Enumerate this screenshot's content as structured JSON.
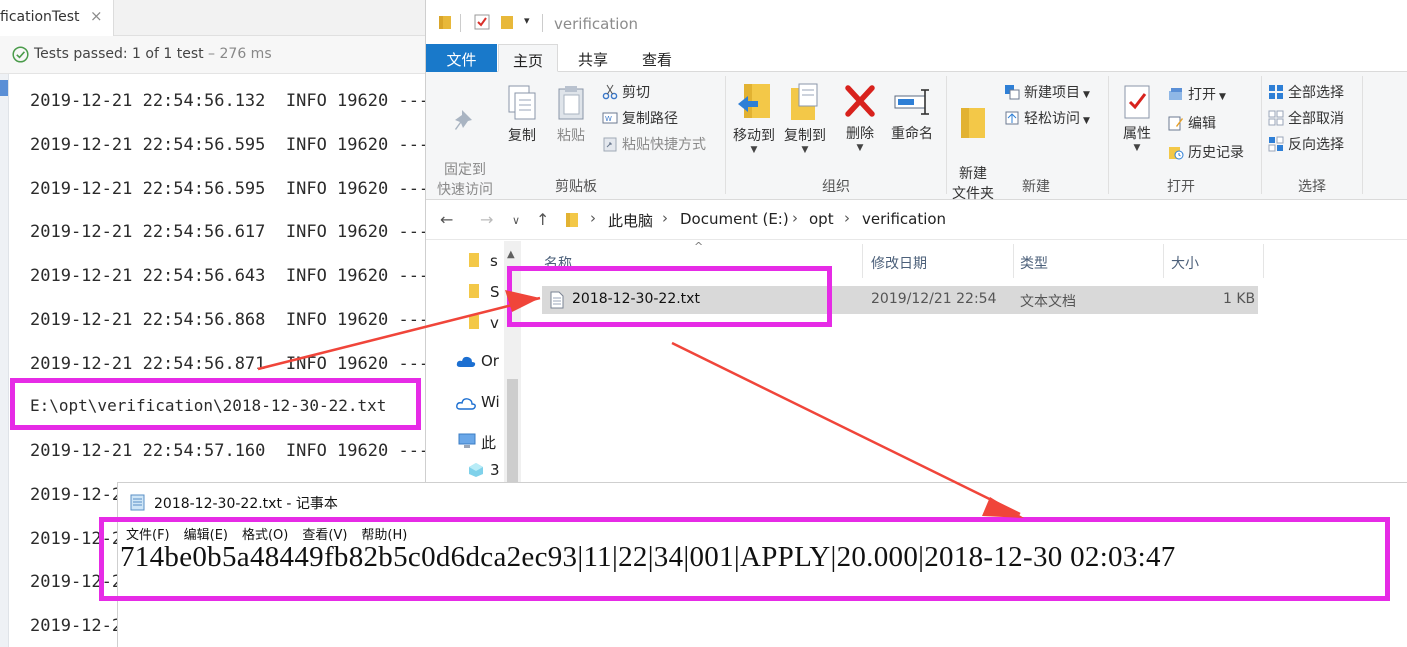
{
  "ide": {
    "tab_title": "ficationTest",
    "tab_close": "×",
    "status_prefix": "Tests passed: ",
    "status_count": "1",
    "status_mid": " of 1 test",
    "status_time": " – 276 ms",
    "log_lines": [
      "2019-12-21 22:54:56.132  INFO 19620 ---",
      "2019-12-21 22:54:56.595  INFO 19620 ---",
      "2019-12-21 22:54:56.595  INFO 19620 ---",
      "2019-12-21 22:54:56.617  INFO 19620 ---",
      "2019-12-21 22:54:56.643  INFO 19620 ---",
      "2019-12-21 22:54:56.868  INFO 19620 ---",
      "2019-12-21 22:54:56.871  INFO 19620 ---",
      "2019-12-21 22:54:57.160  INFO 19620 ---",
      "2019-12-2",
      "2019-12-2",
      "2019-12-2",
      "2019-12-2"
    ],
    "path_line": "E:\\opt\\verification\\2018-12-30-22.txt"
  },
  "explorer": {
    "title": "verification",
    "tabs": {
      "file": "文件",
      "home": "主页",
      "share": "共享",
      "view": "查看"
    },
    "ribbon": {
      "pin": "固定到\n快速访问",
      "copy": "复制",
      "paste": "粘贴",
      "cut": "剪切",
      "copy_path": "复制路径",
      "paste_shortcut": "粘贴快捷方式",
      "clipboard_group": "剪贴板",
      "move_to": "移动到",
      "copy_to": "复制到",
      "delete": "删除",
      "rename": "重命名",
      "organize_group": "组织",
      "new_folder": "新建\n文件夹",
      "new_item": "新建项目",
      "easy_access": "轻松访问",
      "new_group": "新建",
      "properties": "属性",
      "open": "打开",
      "edit": "编辑",
      "history": "历史记录",
      "open_group": "打开",
      "select_all": "全部选择",
      "select_none": "全部取消",
      "invert_selection": "反向选择",
      "select_group": "选择"
    },
    "address": {
      "crumbs": [
        "此电脑",
        "Document (E:)",
        "opt",
        "verification"
      ]
    },
    "nav_items": [
      "s",
      "S",
      "v",
      "Or",
      "Wi",
      "此",
      "3"
    ],
    "columns": {
      "name": "名称",
      "modified": "修改日期",
      "type": "类型",
      "size": "大小"
    },
    "files": [
      {
        "name": "2018-12-30-22.txt",
        "modified": "2019/12/21 22:54",
        "type": "文本文档",
        "size": "1 KB"
      }
    ]
  },
  "notepad": {
    "title": "2018-12-30-22.txt - 记事本",
    "menu": [
      "文件(F)",
      "编辑(E)",
      "格式(O)",
      "查看(V)",
      "帮助(H)"
    ],
    "content": "714be0b5a48449fb82b5c0d6dca2ec93|11|22|34|001|APPLY|20.000|2018-12-30 02:03:47"
  },
  "colors": {
    "highlight_box": "#e62be6",
    "arrow": "#f0453a",
    "file_tab": "#1979ca",
    "selected_row": "#d9d9d9"
  }
}
